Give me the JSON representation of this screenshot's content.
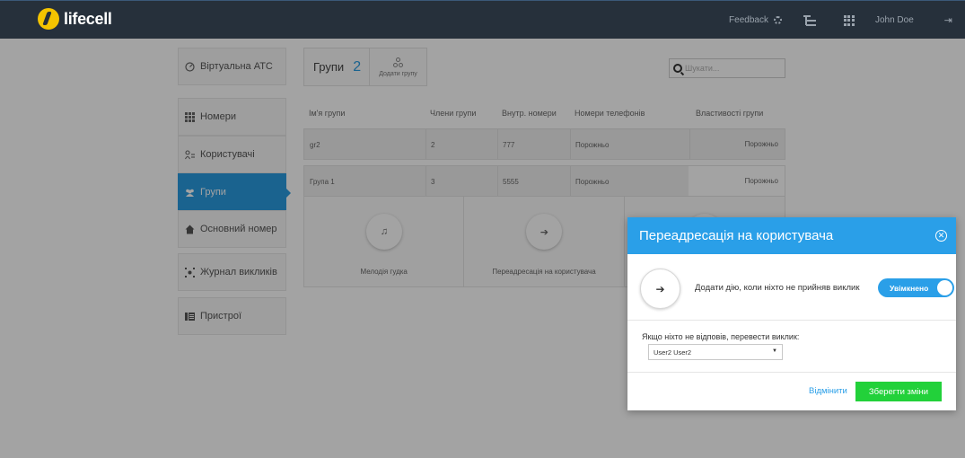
{
  "topbar": {
    "brand": "lifecell",
    "feedback_label": "Feedback",
    "user_name": "John Doe"
  },
  "sidebar": {
    "items": [
      {
        "label": "Віртуальна АТС",
        "icon": "speedometer-icon"
      },
      {
        "label": "Номери",
        "icon": "grid-icon"
      },
      {
        "label": "Користувачі",
        "icon": "user-list-icon"
      },
      {
        "label": "Групи",
        "icon": "users-icon",
        "active": true
      },
      {
        "label": "Основний номер",
        "icon": "home-icon"
      },
      {
        "label": "Журнал викликів",
        "icon": "call-log-icon"
      },
      {
        "label": "Пристрої",
        "icon": "phone-device-icon"
      }
    ]
  },
  "groups": {
    "title": "Групи",
    "count": "2",
    "add_label": "Додати групу"
  },
  "search": {
    "placeholder": "Шукати..."
  },
  "table": {
    "headers": [
      "Ім'я групи",
      "Члени групи",
      "Внутр. номери",
      "Номери телефонів",
      "Властивості групи"
    ],
    "rows": [
      [
        "gr2",
        "2",
        "777",
        "Порожньо",
        "Порожньо"
      ],
      [
        "Група 1",
        "3",
        "5555",
        "Порожньо",
        "Порожньо"
      ]
    ]
  },
  "actions": [
    {
      "label": "Мелодія гудка",
      "icon": "music-note-icon"
    },
    {
      "label": "Переадресація на користувача",
      "icon": "arrow-right-icon"
    }
  ],
  "modal": {
    "title": "Переадресація на користувача",
    "action_text": "Додати дію, коли ніхто не прийняв виклик",
    "toggle_label": "Увімкнено",
    "toggle_on": true,
    "redirect_label": "Якщо ніхто не відповів, перевести виклик:",
    "selected_user": "User2 User2",
    "cancel_label": "Відмінити",
    "save_label": "Зберегти зміни"
  },
  "colors": {
    "topbar": "#26303b",
    "accent": "#2a9be0",
    "save": "#22d13a",
    "brand_yellow": "#f4c400"
  }
}
